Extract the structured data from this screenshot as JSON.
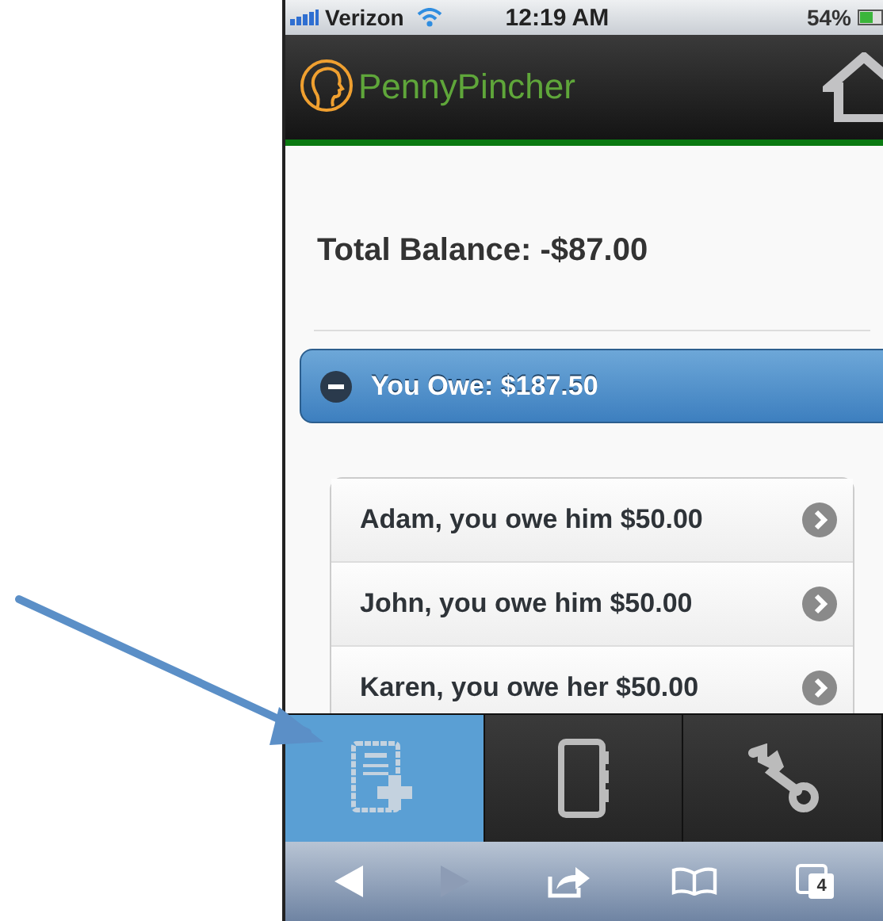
{
  "status_bar": {
    "carrier": "Verizon",
    "time": "12:19 AM",
    "battery": "54%"
  },
  "header": {
    "app_name": "PennyPincher"
  },
  "total_balance": "Total Balance: -$87.00",
  "section": {
    "title": "You Owe: $187.50",
    "expanded": true
  },
  "rows": [
    {
      "text": "Adam, you owe him $50.00"
    },
    {
      "text": "John, you owe him $50.00"
    },
    {
      "text": "Karen, you owe her $50.00"
    }
  ],
  "tabs": [
    {
      "kind": "new-bill",
      "selected": true
    },
    {
      "kind": "address-book",
      "selected": false
    },
    {
      "kind": "settings",
      "selected": false
    }
  ],
  "browser_toolbar": {
    "back_disabled": false,
    "forward_disabled": true,
    "tab_count": "4"
  }
}
